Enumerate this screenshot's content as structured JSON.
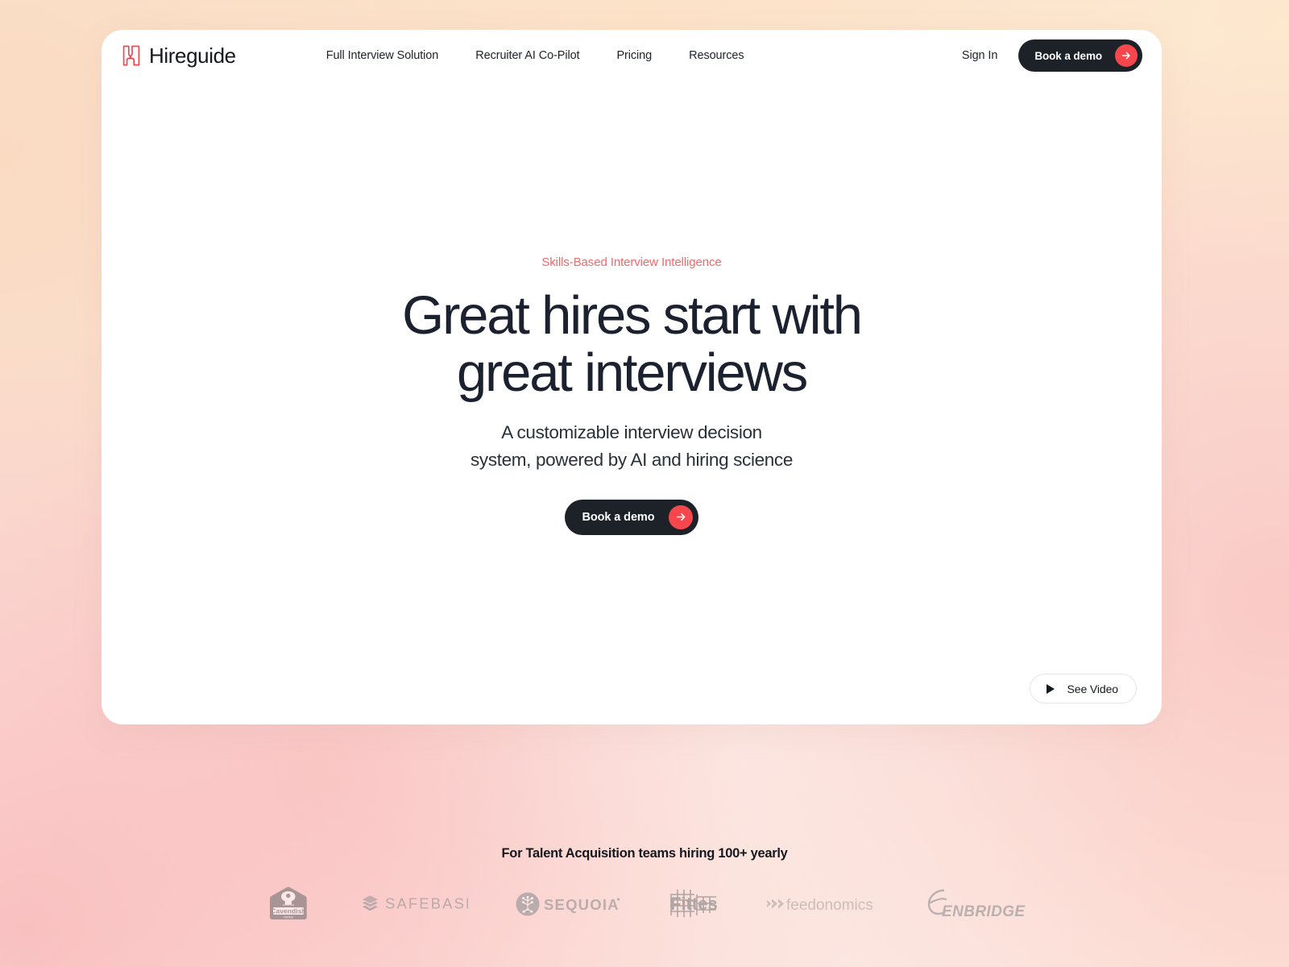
{
  "brand": {
    "name": "Hireguide",
    "logo_icon": "hireguide-h-mark",
    "accent_color": "#f5474c",
    "dark_color": "#1d2229"
  },
  "nav": {
    "links": [
      {
        "label": "Full Interview Solution"
      },
      {
        "label": "Recruiter AI Co-Pilot"
      },
      {
        "label": "Pricing"
      },
      {
        "label": "Resources"
      }
    ],
    "sign_in_label": "Sign In",
    "cta_label": "Book a demo",
    "cta_icon": "arrow-right-icon"
  },
  "hero": {
    "eyebrow": "Skills-Based Interview Intelligence",
    "headline_line1": "Great hires start with",
    "headline_line2": "great interviews",
    "subhead_line1": "A customizable interview decision",
    "subhead_line2": "system, powered by AI and hiring science",
    "cta_label": "Book a demo",
    "cta_icon": "arrow-right-icon"
  },
  "video": {
    "label": "See Video",
    "icon": "play-icon"
  },
  "proof": {
    "title": "For Talent Acquisition teams hiring 100+ yearly",
    "logos": [
      {
        "name": "Cavendish",
        "icon": "cavendish-logo"
      },
      {
        "name": "SAFEBASE",
        "icon": "safebase-logo"
      },
      {
        "name": "SEQUOIA",
        "icon": "sequoia-logo"
      },
      {
        "name": "Fittes",
        "icon": "fittes-logo"
      },
      {
        "name": "feedonomics",
        "icon": "feedonomics-logo"
      },
      {
        "name": "ENBRIDGE",
        "icon": "enbridge-logo"
      }
    ]
  }
}
